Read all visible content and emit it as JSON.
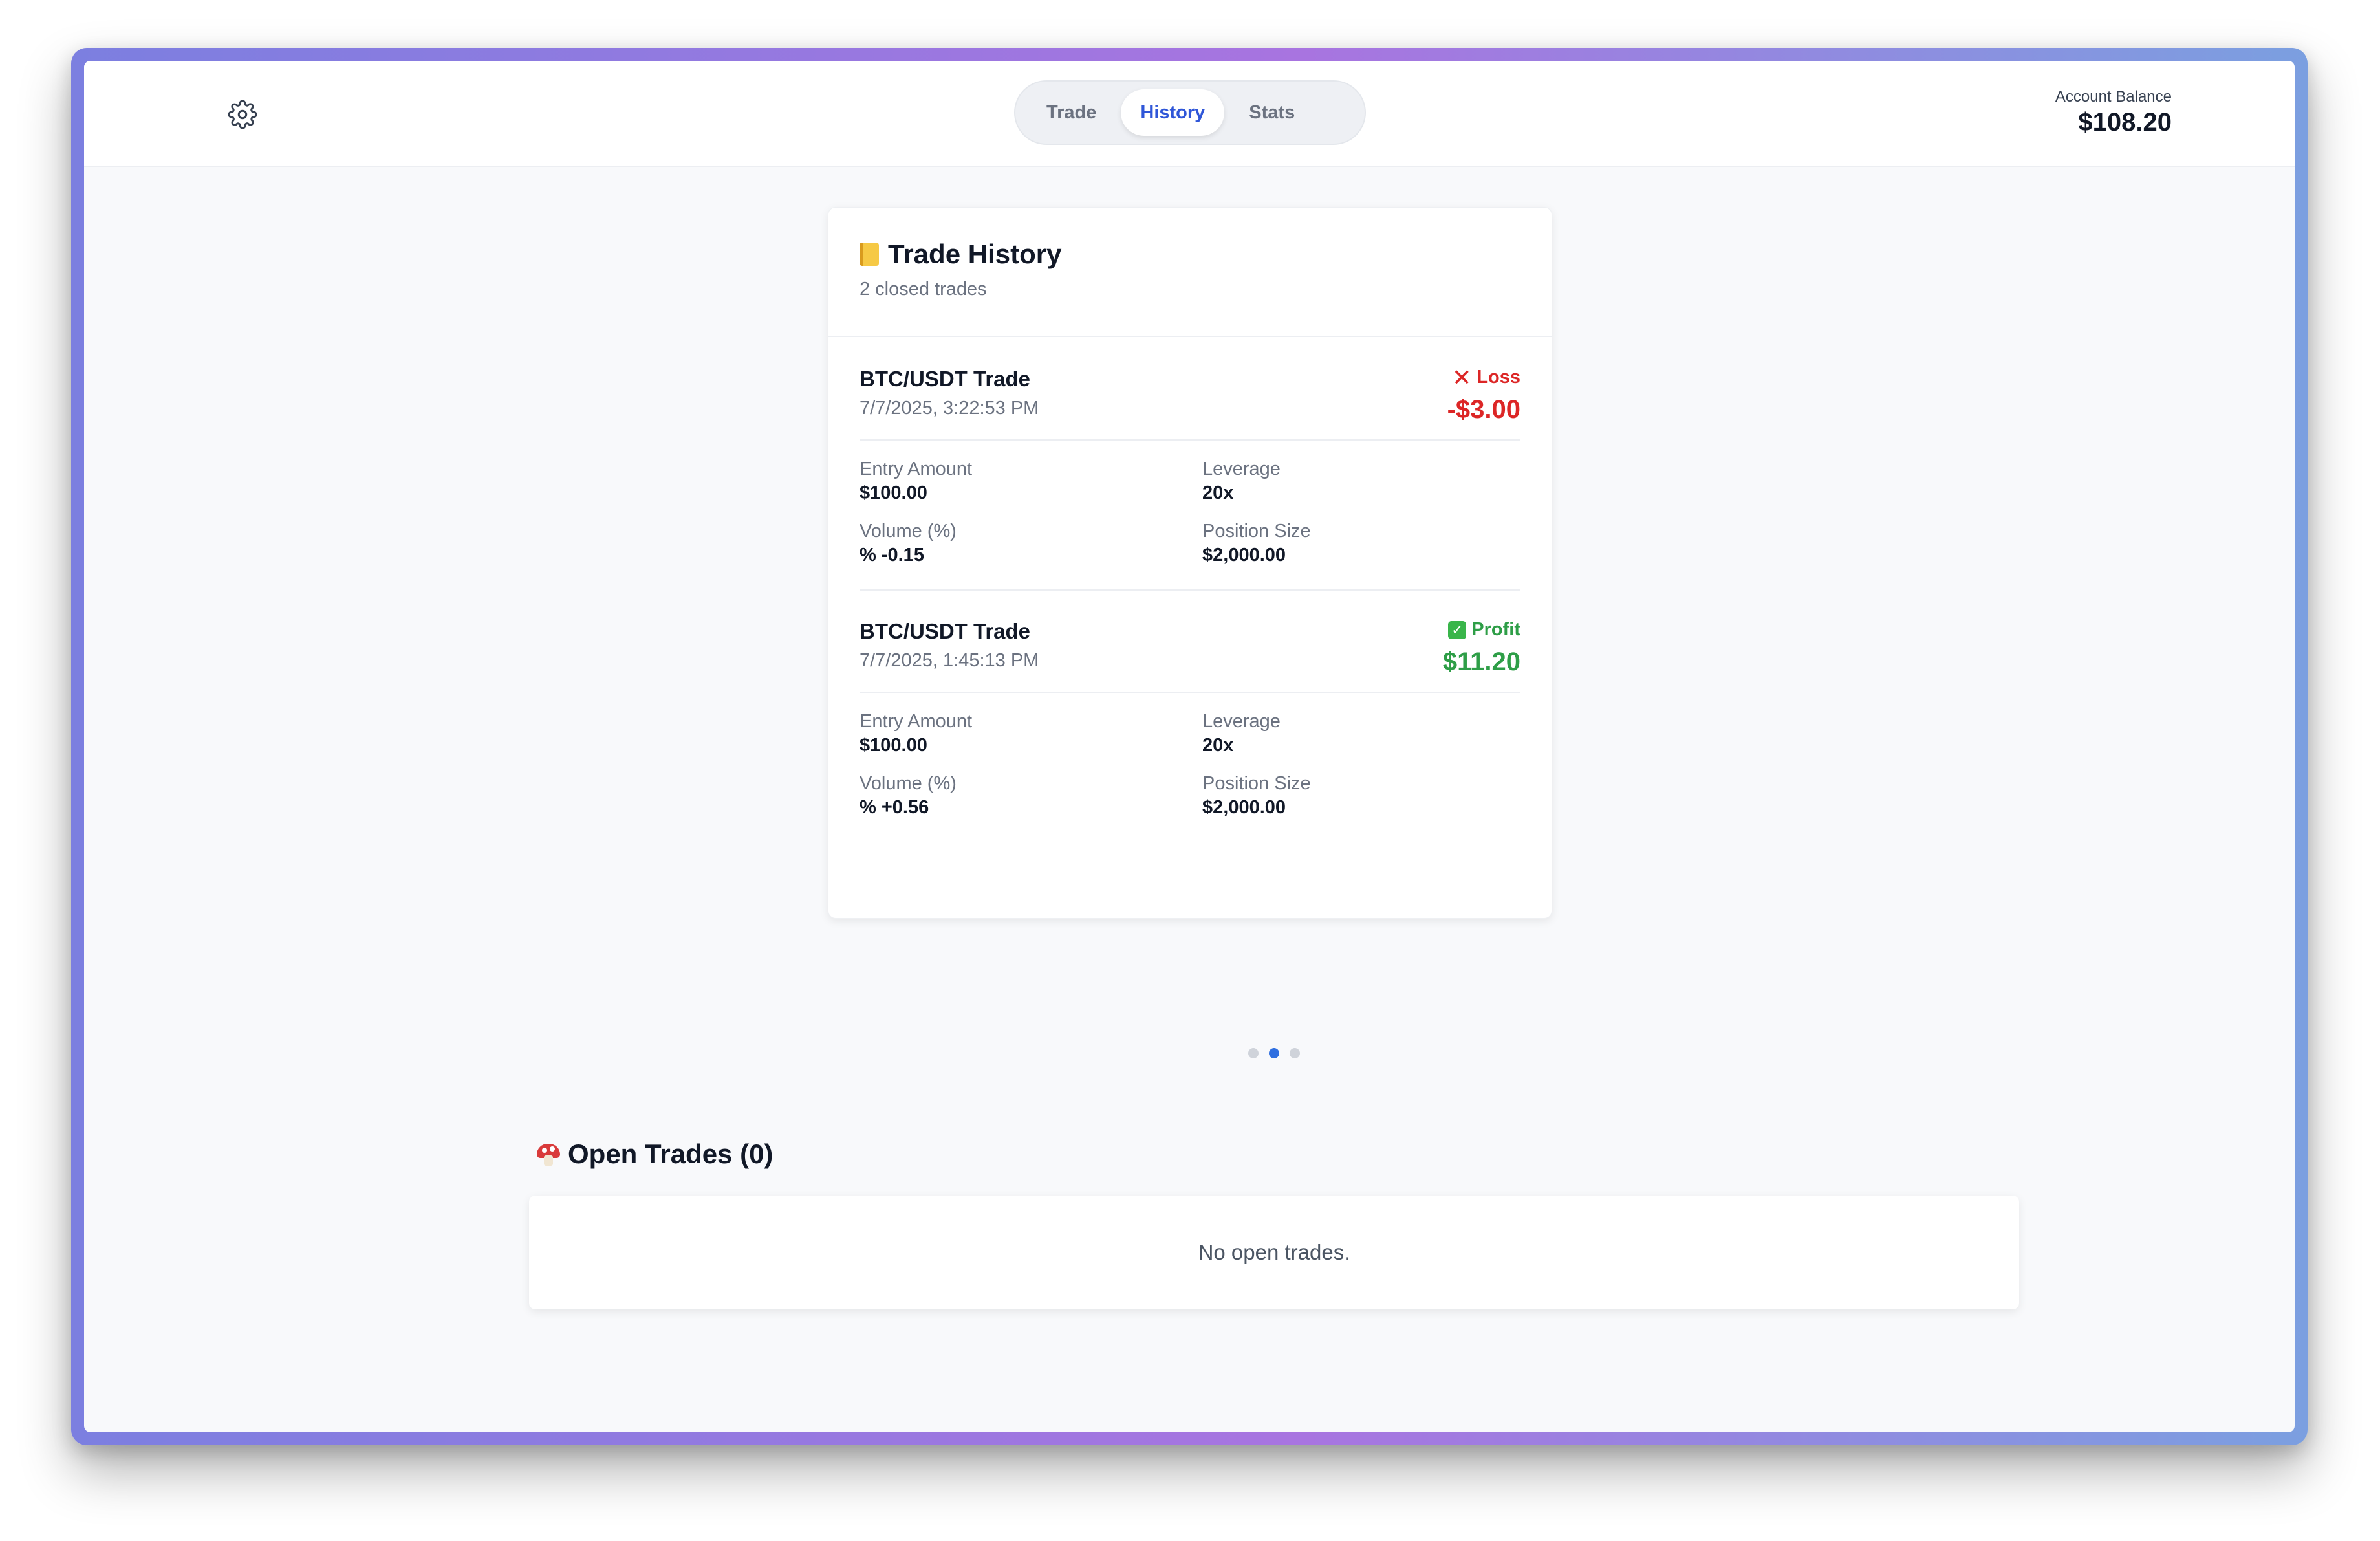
{
  "header": {
    "tabs": [
      {
        "label": "Trade",
        "active": false
      },
      {
        "label": "History",
        "active": true
      },
      {
        "label": "Stats",
        "active": false
      }
    ],
    "balance_label": "Account Balance",
    "balance_value": "$108.20"
  },
  "history": {
    "title": "Trade History",
    "subtitle": "2 closed trades",
    "trades": [
      {
        "pair": "BTC/USDT Trade",
        "date": "7/7/2025, 3:22:53 PM",
        "status": "Loss",
        "amount": "-$3.00",
        "entry_label": "Entry Amount",
        "entry_value": "$100.00",
        "leverage_label": "Leverage",
        "leverage_value": "20x",
        "volume_label": "Volume (%)",
        "volume_value": "% -0.15",
        "position_label": "Position Size",
        "position_value": "$2,000.00"
      },
      {
        "pair": "BTC/USDT Trade",
        "date": "7/7/2025, 1:45:13 PM",
        "status": "Profit",
        "amount": "$11.20",
        "entry_label": "Entry Amount",
        "entry_value": "$100.00",
        "leverage_label": "Leverage",
        "leverage_value": "20x",
        "volume_label": "Volume (%)",
        "volume_value": "% +0.56",
        "position_label": "Position Size",
        "position_value": "$2,000.00"
      }
    ]
  },
  "pager": {
    "count": 3,
    "active_index": 1
  },
  "open_trades": {
    "title": "Open Trades (0)",
    "empty_text": "No open trades."
  },
  "colors": {
    "accent": "#2f56d8",
    "loss": "#dc2626",
    "profit": "#2e9e47"
  },
  "icons": {
    "settings": "gear-icon",
    "history_title": "ledger-icon",
    "loss": "cross-mark-icon",
    "profit": "check-mark-icon",
    "open_trades_title": "mushroom-icon"
  }
}
